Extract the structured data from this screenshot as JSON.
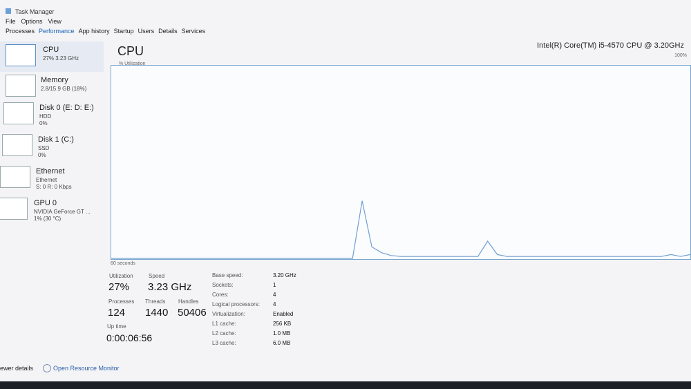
{
  "window": {
    "title": "Task Manager"
  },
  "menu": [
    "File",
    "Options",
    "View"
  ],
  "tabs": [
    "Processes",
    "Performance",
    "App history",
    "Startup",
    "Users",
    "Details",
    "Services"
  ],
  "sidebar": [
    {
      "name": "CPU",
      "sub1": "27%  3.23 GHz"
    },
    {
      "name": "Memory",
      "sub1": "2.8/15.9 GB (18%)"
    },
    {
      "name": "Disk 0 (E: D: E:)",
      "sub1": "HDD",
      "sub2": "0%"
    },
    {
      "name": "Disk 1 (C:)",
      "sub1": "SSD",
      "sub2": "0%"
    },
    {
      "name": "Ethernet",
      "sub1": "Ethernet",
      "sub2": "S: 0 R: 0 Kbps"
    },
    {
      "name": "GPU 0",
      "sub1": "NVIDIA GeForce GT ...",
      "sub2": "1% (30 °C)"
    }
  ],
  "main": {
    "title": "CPU",
    "model": "Intel(R) Core(TM) i5-4570 CPU @ 3.20GHz",
    "util_label": "% Utilization",
    "max_label": "100%",
    "time_label": "60 seconds",
    "utilization_series": [
      0,
      0,
      0,
      0,
      0,
      0,
      0,
      0,
      0,
      0,
      0,
      0,
      0,
      0,
      0,
      0,
      0,
      0,
      0,
      0,
      0,
      0,
      0,
      0,
      0,
      0,
      30,
      6,
      3,
      1.5,
      1,
      1,
      1,
      1,
      1,
      1,
      1,
      1,
      1,
      9,
      2,
      1,
      1,
      1,
      1,
      1,
      1,
      1,
      1,
      1,
      1,
      1,
      1,
      1,
      1,
      1,
      1,
      1,
      2,
      1,
      2
    ]
  },
  "stats": {
    "utilization_label": "Utilization",
    "utilization": "27%",
    "speed_label": "Speed",
    "speed": "3.23 GHz",
    "processes_label": "Processes",
    "processes": "124",
    "threads_label": "Threads",
    "threads": "1440",
    "handles_label": "Handles",
    "handles": "50406",
    "uptime_label": "Up time",
    "uptime": "0:00:06:56"
  },
  "details": [
    {
      "key": "Base speed:",
      "value": "3.20 GHz"
    },
    {
      "key": "Sockets:",
      "value": "1"
    },
    {
      "key": "Cores:",
      "value": "4"
    },
    {
      "key": "Logical processors:",
      "value": "4"
    },
    {
      "key": "Virtualization:",
      "value": "Enabled"
    },
    {
      "key": "L1 cache:",
      "value": "256 KB"
    },
    {
      "key": "L2 cache:",
      "value": "1.0 MB"
    },
    {
      "key": "L3 cache:",
      "value": "6.0 MB"
    }
  ],
  "footer": {
    "fewer": "ewer details",
    "monitor": "Open Resource Monitor"
  },
  "colors": {
    "graph_line": "#6f9fcf",
    "graph_grid": "#d3dde8",
    "graph_border": "#7aa7d3"
  }
}
